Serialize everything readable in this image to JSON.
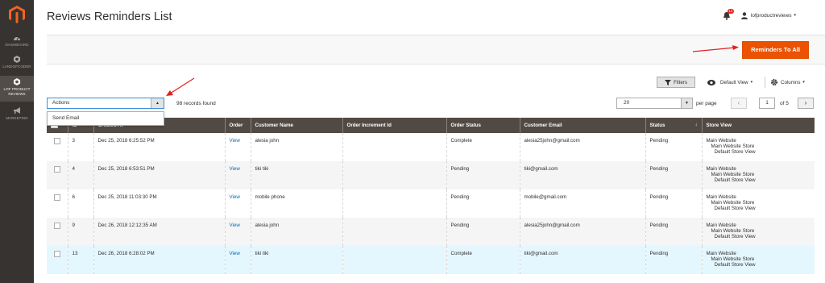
{
  "page": {
    "title": "Reviews Reminders List"
  },
  "sidebar": {
    "items": [
      {
        "label": "DASHBOARD",
        "icon": "dashboard-icon"
      },
      {
        "label": "LANDOFCODER",
        "icon": "hexagon-icon"
      },
      {
        "label_line1": "LOF PRODUCT",
        "label_line2": "REVIEWS",
        "icon": "hexagon-icon",
        "active": true
      },
      {
        "label": "MARKETING",
        "icon": "megaphone-icon"
      }
    ]
  },
  "header": {
    "notifications_count": "12",
    "username": "lofproductreviews"
  },
  "action_bar": {
    "primary_button": "Reminders To All"
  },
  "toolbar": {
    "filters": "Filters",
    "view": "Default View",
    "columns": "Columns",
    "actions_placeholder": "Actions",
    "actions_options": [
      "Send Email"
    ],
    "records_found": "98 records found",
    "per_page_value": "20",
    "per_page_label": "per page",
    "current_page": "1",
    "total_pages": "of 5"
  },
  "grid": {
    "columns": [
      "ID",
      "Created At",
      "Order",
      "Customer Name",
      "Order Increment Id",
      "Order Status",
      "Customer Email",
      "Status",
      "Store View"
    ],
    "store_view": {
      "line1": "Main Website",
      "line2": "Main Website Store",
      "line3": "Default Store View"
    },
    "rows": [
      {
        "id": "3",
        "created_at": "Dec 25, 2018 6:25:52 PM",
        "order": "View",
        "customer_name": "alesia john",
        "increment_id": "",
        "order_status": "Complete",
        "email": "alesia25john@gmail.com",
        "status": "Pending"
      },
      {
        "id": "4",
        "created_at": "Dec 25, 2018 6:53:51 PM",
        "order": "View",
        "customer_name": "tiki tiki",
        "increment_id": "",
        "order_status": "Pending",
        "email": "tiki@gmail.com",
        "status": "Pending"
      },
      {
        "id": "6",
        "created_at": "Dec 25, 2018 11:03:30 PM",
        "order": "View",
        "customer_name": "mobile phone",
        "increment_id": "",
        "order_status": "Pending",
        "email": "mobile@gmail.com",
        "status": "Pending"
      },
      {
        "id": "9",
        "created_at": "Dec 26, 2018 12:12:35 AM",
        "order": "View",
        "customer_name": "alesia john",
        "increment_id": "",
        "order_status": "Pending",
        "email": "alesia25john@gmail.com",
        "status": "Pending"
      },
      {
        "id": "13",
        "created_at": "Dec 26, 2018 6:28:02 PM",
        "order": "View",
        "customer_name": "tiki tiki",
        "increment_id": "",
        "order_status": "Complete",
        "email": "tiki@gmail.com",
        "status": "Pending"
      }
    ]
  },
  "colors": {
    "accent": "#eb5202",
    "sidebar": "#373330",
    "header_row": "#514943",
    "annotation": "#e02020"
  }
}
